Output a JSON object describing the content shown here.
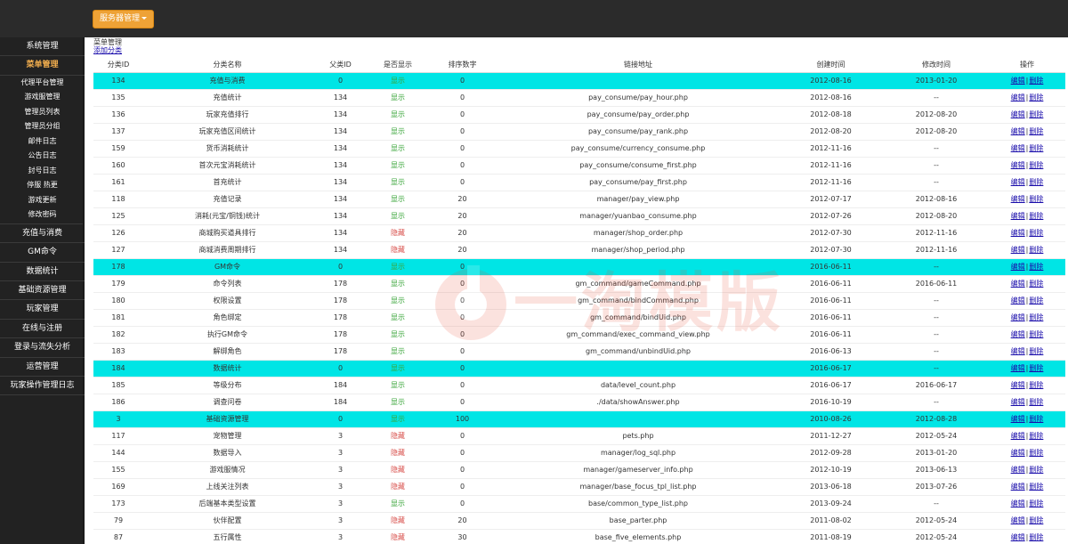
{
  "header": {
    "server_button": "服务器管理"
  },
  "sidebar": {
    "items": [
      {
        "label": "系统管理",
        "active": false
      },
      {
        "label": "菜单管理",
        "active": true,
        "subitems": [
          "代理平台管理",
          "游戏服管理",
          "管理员列表",
          "管理员分组",
          "邮件日志",
          "公告日志",
          "封号日志",
          "停服 热更",
          "游戏更新",
          "修改密码"
        ]
      },
      {
        "label": "充值与消费"
      },
      {
        "label": "GM命令"
      },
      {
        "label": "数据统计"
      },
      {
        "label": "基础资源管理"
      },
      {
        "label": "玩家管理"
      },
      {
        "label": "在线与注册"
      },
      {
        "label": "登录与流失分析"
      },
      {
        "label": "运营管理"
      },
      {
        "label": "玩家操作管理日志"
      }
    ]
  },
  "main": {
    "breadcrumb": "菜单管理",
    "add_link": "添加分类",
    "watermark": "一淘模版",
    "columns": [
      "分类ID",
      "分类名称",
      "父类ID",
      "是否显示",
      "排序数字",
      "链接地址",
      "创建时间",
      "修改时间",
      "操作"
    ],
    "op_edit": "编辑",
    "op_sep": "|",
    "op_delete": "删除",
    "rows": [
      {
        "id": "134",
        "name": "充值与消费",
        "pid": "0",
        "display": "显示",
        "visible": true,
        "sort": "0",
        "url": "",
        "created": "2012-08-16",
        "modified": "2013-01-20",
        "highlight": true
      },
      {
        "id": "135",
        "name": "充值统计",
        "pid": "134",
        "display": "显示",
        "visible": true,
        "sort": "0",
        "url": "pay_consume/pay_hour.php",
        "created": "2012-08-16",
        "modified": "--",
        "highlight": false
      },
      {
        "id": "136",
        "name": "玩家充值排行",
        "pid": "134",
        "display": "显示",
        "visible": true,
        "sort": "0",
        "url": "pay_consume/pay_order.php",
        "created": "2012-08-18",
        "modified": "2012-08-20",
        "highlight": false
      },
      {
        "id": "137",
        "name": "玩家充值区间统计",
        "pid": "134",
        "display": "显示",
        "visible": true,
        "sort": "0",
        "url": "pay_consume/pay_rank.php",
        "created": "2012-08-20",
        "modified": "2012-08-20",
        "highlight": false
      },
      {
        "id": "159",
        "name": "货币消耗统计",
        "pid": "134",
        "display": "显示",
        "visible": true,
        "sort": "0",
        "url": "pay_consume/currency_consume.php",
        "created": "2012-11-16",
        "modified": "--",
        "highlight": false
      },
      {
        "id": "160",
        "name": "首次元宝消耗统计",
        "pid": "134",
        "display": "显示",
        "visible": true,
        "sort": "0",
        "url": "pay_consume/consume_first.php",
        "created": "2012-11-16",
        "modified": "--",
        "highlight": false
      },
      {
        "id": "161",
        "name": "首充统计",
        "pid": "134",
        "display": "显示",
        "visible": true,
        "sort": "0",
        "url": "pay_consume/pay_first.php",
        "created": "2012-11-16",
        "modified": "--",
        "highlight": false
      },
      {
        "id": "118",
        "name": "充值记录",
        "pid": "134",
        "display": "显示",
        "visible": true,
        "sort": "20",
        "url": "manager/pay_view.php",
        "created": "2012-07-17",
        "modified": "2012-08-16",
        "highlight": false
      },
      {
        "id": "125",
        "name": "消耗(元宝/铜钱)统计",
        "pid": "134",
        "display": "显示",
        "visible": true,
        "sort": "20",
        "url": "manager/yuanbao_consume.php",
        "created": "2012-07-26",
        "modified": "2012-08-20",
        "highlight": false
      },
      {
        "id": "126",
        "name": "商城购买道具排行",
        "pid": "134",
        "display": "隐藏",
        "visible": false,
        "sort": "20",
        "url": "manager/shop_order.php",
        "created": "2012-07-30",
        "modified": "2012-11-16",
        "highlight": false
      },
      {
        "id": "127",
        "name": "商城消费周期排行",
        "pid": "134",
        "display": "隐藏",
        "visible": false,
        "sort": "20",
        "url": "manager/shop_period.php",
        "created": "2012-07-30",
        "modified": "2012-11-16",
        "highlight": false
      },
      {
        "id": "178",
        "name": "GM命令",
        "pid": "0",
        "display": "显示",
        "visible": true,
        "sort": "0",
        "url": "",
        "created": "2016-06-11",
        "modified": "--",
        "highlight": true
      },
      {
        "id": "179",
        "name": "命令列表",
        "pid": "178",
        "display": "显示",
        "visible": true,
        "sort": "0",
        "url": "gm_command/gameCommand.php",
        "created": "2016-06-11",
        "modified": "2016-06-11",
        "highlight": false
      },
      {
        "id": "180",
        "name": "权限设置",
        "pid": "178",
        "display": "显示",
        "visible": true,
        "sort": "0",
        "url": "gm_command/bindCommand.php",
        "created": "2016-06-11",
        "modified": "--",
        "highlight": false
      },
      {
        "id": "181",
        "name": "角色绑定",
        "pid": "178",
        "display": "显示",
        "visible": true,
        "sort": "0",
        "url": "gm_command/bindUid.php",
        "created": "2016-06-11",
        "modified": "--",
        "highlight": false
      },
      {
        "id": "182",
        "name": "执行GM命令",
        "pid": "178",
        "display": "显示",
        "visible": true,
        "sort": "0",
        "url": "gm_command/exec_command_view.php",
        "created": "2016-06-11",
        "modified": "--",
        "highlight": false
      },
      {
        "id": "183",
        "name": "解绑角色",
        "pid": "178",
        "display": "显示",
        "visible": true,
        "sort": "0",
        "url": "gm_command/unbindUid.php",
        "created": "2016-06-13",
        "modified": "--",
        "highlight": false
      },
      {
        "id": "184",
        "name": "数据统计",
        "pid": "0",
        "display": "显示",
        "visible": true,
        "sort": "0",
        "url": "",
        "created": "2016-06-17",
        "modified": "--",
        "highlight": true
      },
      {
        "id": "185",
        "name": "等级分布",
        "pid": "184",
        "display": "显示",
        "visible": true,
        "sort": "0",
        "url": "data/level_count.php",
        "created": "2016-06-17",
        "modified": "2016-06-17",
        "highlight": false
      },
      {
        "id": "186",
        "name": "调查问卷",
        "pid": "184",
        "display": "显示",
        "visible": true,
        "sort": "0",
        "url": "./data/showAnswer.php",
        "created": "2016-10-19",
        "modified": "--",
        "highlight": false
      },
      {
        "id": "3",
        "name": "基础资源管理",
        "pid": "0",
        "display": "显示",
        "visible": true,
        "sort": "100",
        "url": "",
        "created": "2010-08-26",
        "modified": "2012-08-28",
        "highlight": true
      },
      {
        "id": "117",
        "name": "宠物管理",
        "pid": "3",
        "display": "隐藏",
        "visible": false,
        "sort": "0",
        "url": "pets.php",
        "created": "2011-12-27",
        "modified": "2012-05-24",
        "highlight": false
      },
      {
        "id": "144",
        "name": "数据导入",
        "pid": "3",
        "display": "隐藏",
        "visible": false,
        "sort": "0",
        "url": "manager/log_sql.php",
        "created": "2012-09-28",
        "modified": "2013-01-20",
        "highlight": false
      },
      {
        "id": "155",
        "name": "游戏服情况",
        "pid": "3",
        "display": "隐藏",
        "visible": false,
        "sort": "0",
        "url": "manager/gameserver_info.php",
        "created": "2012-10-19",
        "modified": "2013-06-13",
        "highlight": false
      },
      {
        "id": "169",
        "name": "上线关注列表",
        "pid": "3",
        "display": "隐藏",
        "visible": false,
        "sort": "0",
        "url": "manager/base_focus_tpl_list.php",
        "created": "2013-06-18",
        "modified": "2013-07-26",
        "highlight": false
      },
      {
        "id": "173",
        "name": "后端基本类型设置",
        "pid": "3",
        "display": "显示",
        "visible": true,
        "sort": "0",
        "url": "base/common_type_list.php",
        "created": "2013-09-24",
        "modified": "--",
        "highlight": false
      },
      {
        "id": "79",
        "name": "伙伴配置",
        "pid": "3",
        "display": "隐藏",
        "visible": false,
        "sort": "20",
        "url": "base_parter.php",
        "created": "2011-08-02",
        "modified": "2012-05-24",
        "highlight": false
      },
      {
        "id": "87",
        "name": "五行属性",
        "pid": "3",
        "display": "隐藏",
        "visible": false,
        "sort": "30",
        "url": "base_five_elements.php",
        "created": "2011-08-19",
        "modified": "2012-05-24",
        "highlight": false
      }
    ]
  }
}
